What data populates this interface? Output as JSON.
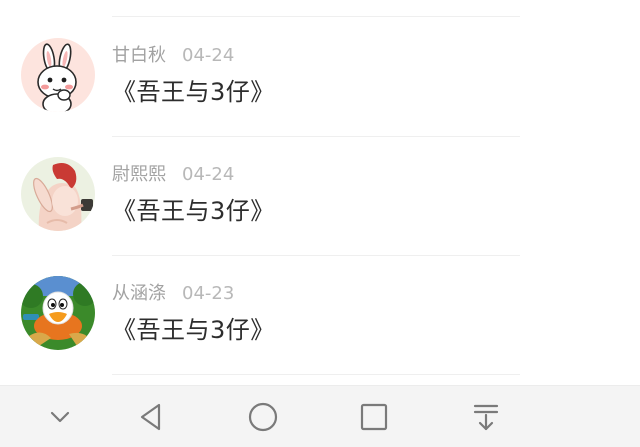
{
  "comments": [
    {
      "username": "甘白秋",
      "date": "04-24",
      "text": "《吾王与3仔》",
      "avatar_icon": "white-rabbit-avatar"
    },
    {
      "username": "尉熙熙",
      "date": "04-24",
      "text": "《吾王与3仔》",
      "avatar_icon": "anime-character-avatar"
    },
    {
      "username": "从涵涤",
      "date": "04-23",
      "text": "《吾王与3仔》",
      "avatar_icon": "cartoon-duck-avatar"
    }
  ],
  "nav_bar": {
    "buttons": [
      "collapse-down-icon",
      "back-icon",
      "home-icon",
      "recent-apps-icon",
      "pull-down-icon"
    ]
  },
  "colors": {
    "username": "#a2a2a2",
    "date": "#b8b8b8",
    "comment_text": "#2d2d2d",
    "divider": "#efefef",
    "nav_background": "#f4f4f4",
    "nav_icon": "#7a7a7a"
  }
}
